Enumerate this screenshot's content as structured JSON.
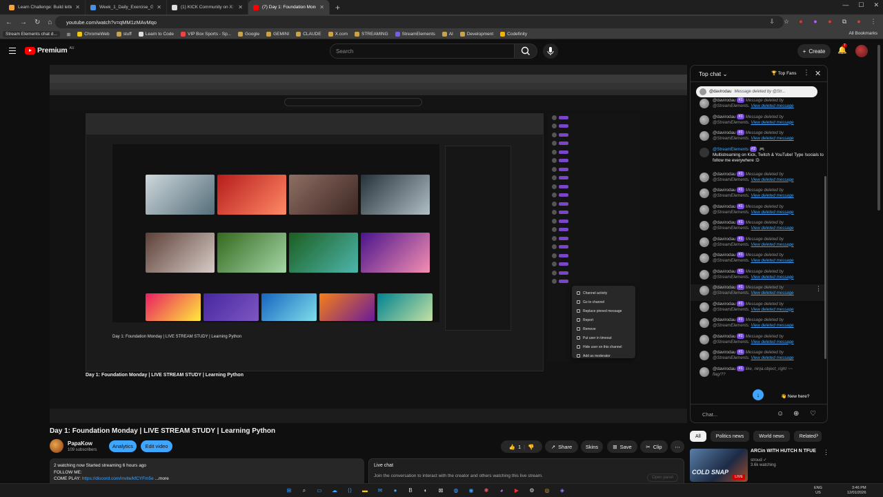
{
  "browser": {
    "tabs": [
      {
        "title": "Learn Challenge: Build letter K",
        "color": "#f2a33a"
      },
      {
        "title": "Week_1_Daily_Exercise_Guide.d",
        "color": "#4a90e2"
      },
      {
        "title": "(1) KICK Community on X: \"@p",
        "color": "#dddddd"
      },
      {
        "title": "(7) Day 1: Foundation Monday",
        "color": "#ff0000"
      }
    ],
    "url": "youtube.com/watch?v=qMM1zMAvMqo",
    "bookmarks": [
      "Stream Elements chat d...",
      "ChromeWeb",
      "stuff",
      "Learn to Code",
      "VIP Box Sports - Sp...",
      "Google",
      "GEMINI",
      "CLAUDE",
      "X.com",
      "STREAMING",
      "StreamElements",
      "AI",
      "Development",
      "Codefinity"
    ],
    "all_bookmarks": "All Bookmarks"
  },
  "youtube": {
    "logo_text": "Premium",
    "region": "AU",
    "search_placeholder": "Search",
    "create_label": "Create",
    "notif_count": "7"
  },
  "video": {
    "title": "Day 1: Foundation Monday | LIVE STREAM STUDY | Learning Python",
    "channel": "PapaKow",
    "subscribers": "109 subscribers",
    "analytics_label": "Analytics",
    "edit_label": "Edit video",
    "likes": "1",
    "share_label": "Share",
    "skins_label": "Skins",
    "save_label": "Save",
    "clip_label": "Clip",
    "desc_line1": "2 watching now  Started streaming 6 hours ago",
    "desc_line2": "FOLLOW ME:",
    "desc_line3_prefix": "COME PLAY: ",
    "desc_link": "https://discord.com/invite/kfCYFm5e",
    "desc_more": "...more",
    "livechat_label": "Live chat",
    "livechat_text": "Join the conversation to interact with the creator and others watching this live stream.",
    "open_panel": "Open panel"
  },
  "inner": {
    "title": "Day 1: Foundation Monday | LIVE STREAM STUDY | Learning Python",
    "ctx_menu": [
      "Channel activity",
      "Go to channel",
      "Replace pinned message",
      "Report",
      "Remove",
      "Put user in timeout",
      "Hide user on this channel",
      "Add as moderator"
    ]
  },
  "chat": {
    "header": "Top chat",
    "top_fans": "Top Fans",
    "pinned_user": "@davirodau",
    "pinned_text": "Message deleted by @Str...",
    "user": "@davirodau",
    "badge": "#1",
    "deleted_text": "Message deleted by",
    "deleted_by": "@StreamElements.",
    "view_text": "View deleted message",
    "se_user": "@StreamElements",
    "se_badge": "#2",
    "se_message": "Multistreaming on Kick, Twitch & YouTube! Type !socials to follow me everywhere :D",
    "last_text": "like, ninja.object_right ~~",
    "last_emote": "flag/??",
    "new_here": "New here?",
    "input_placeholder": "Chat..."
  },
  "related": {
    "chips": [
      "All",
      "Politics news",
      "World news",
      "Related"
    ],
    "video_title": "ARCin WITH HUTCH N TFUE",
    "video_channel": "stroud",
    "video_watching": "3.6k watching",
    "thumb_text": "COLD SNAP",
    "live": "LIVE"
  },
  "taskbar": {
    "lang": "ENG",
    "region": "US",
    "time": "3:46 PM",
    "date": "12/01/2026"
  }
}
